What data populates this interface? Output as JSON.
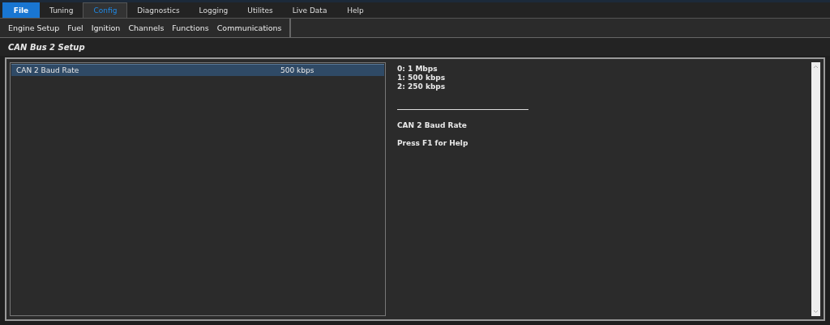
{
  "menu_tabs": [
    {
      "label": "File",
      "kind": "file",
      "selected": false
    },
    {
      "label": "Tuning",
      "kind": "tab",
      "selected": false
    },
    {
      "label": "Config",
      "kind": "tab",
      "selected": true
    },
    {
      "label": "Diagnostics",
      "kind": "tab",
      "selected": false
    },
    {
      "label": "Logging",
      "kind": "tab",
      "selected": false
    },
    {
      "label": "Utilites",
      "kind": "tab",
      "selected": false
    },
    {
      "label": "Live Data",
      "kind": "tab",
      "selected": false
    },
    {
      "label": "Help",
      "kind": "tab",
      "selected": false
    }
  ],
  "submenu": [
    "Engine Setup",
    "Fuel",
    "Ignition",
    "Channels",
    "Functions",
    "Communications"
  ],
  "section_title": "CAN Bus 2 Setup",
  "settings": [
    {
      "name": "CAN 2 Baud Rate",
      "value": "500 kbps",
      "selected": true
    }
  ],
  "help": {
    "options": [
      "0: 1 Mbps",
      "1: 500 kbps",
      "2: 250 kbps"
    ],
    "setting_name": "CAN 2 Baud Rate",
    "hint": "Press F1 for Help"
  }
}
